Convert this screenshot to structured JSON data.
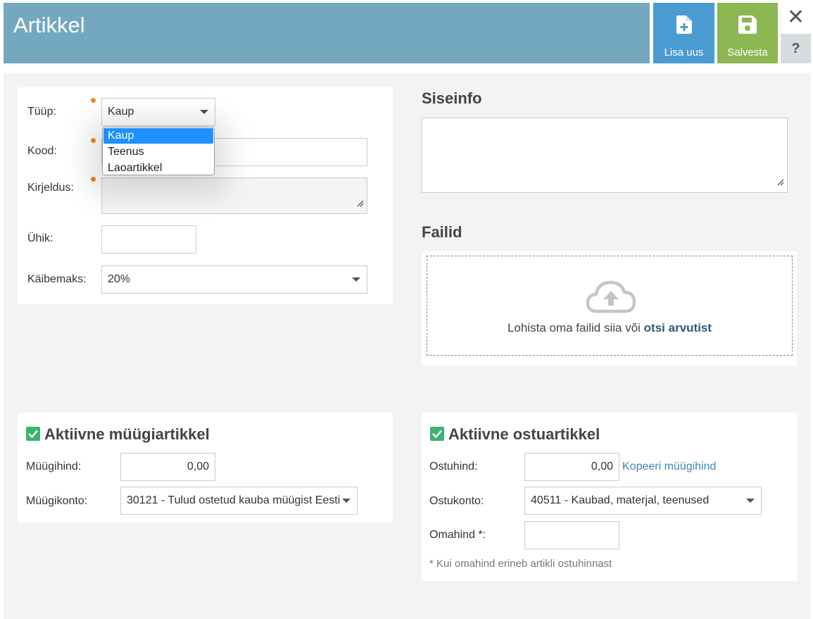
{
  "header": {
    "title": "Artikkel",
    "add_new_label": "Lisa uus",
    "save_label": "Salvesta",
    "close_glyph": "✕",
    "help_glyph": "?"
  },
  "form": {
    "type_label": "Tüüp:",
    "type_value": "Kaup",
    "type_options": [
      "Kaup",
      "Teenus",
      "Laoartikkel"
    ],
    "code_label": "Kood:",
    "code_value": "",
    "description_label": "Kirjeldus:",
    "description_value": "",
    "unit_label": "Ühik:",
    "unit_value": "",
    "vat_label": "Käibemaks:",
    "vat_value": "20%"
  },
  "internal_info": {
    "title": "Siseinfo",
    "value": ""
  },
  "files": {
    "title": "Failid",
    "drop_text": "Lohista oma failid siia või",
    "browse_link": "otsi arvutist"
  },
  "sales": {
    "title": "Aktiivne müügiartikkel",
    "price_label": "Müügihind:",
    "price_value": "0,00",
    "account_label": "Müügikonto:",
    "account_value": "30121 - Tulud ostetud kauba müügist Eesti"
  },
  "purchase": {
    "title": "Aktiivne ostuartikkel",
    "price_label": "Ostuhind:",
    "price_value": "0,00",
    "copy_link": "Kopeeri müügihind",
    "account_label": "Ostukonto:",
    "account_value": "40511 - Kaubad, materjal, teenused",
    "cost_label": "Omahind *:",
    "cost_value": "",
    "note": "* Kui omahind erineb artikli ostuhinnast"
  },
  "icons": {
    "add": "file-plus-icon",
    "save": "floppy-disk-icon",
    "upload": "cloud-upload-icon",
    "checkbox": "checkbox-checked-icon"
  },
  "colors": {
    "header": "#74a8be",
    "add_button": "#4a9bd1",
    "save_button": "#8db753",
    "checkbox": "#3cb371",
    "required_dot": "#e8872c"
  }
}
